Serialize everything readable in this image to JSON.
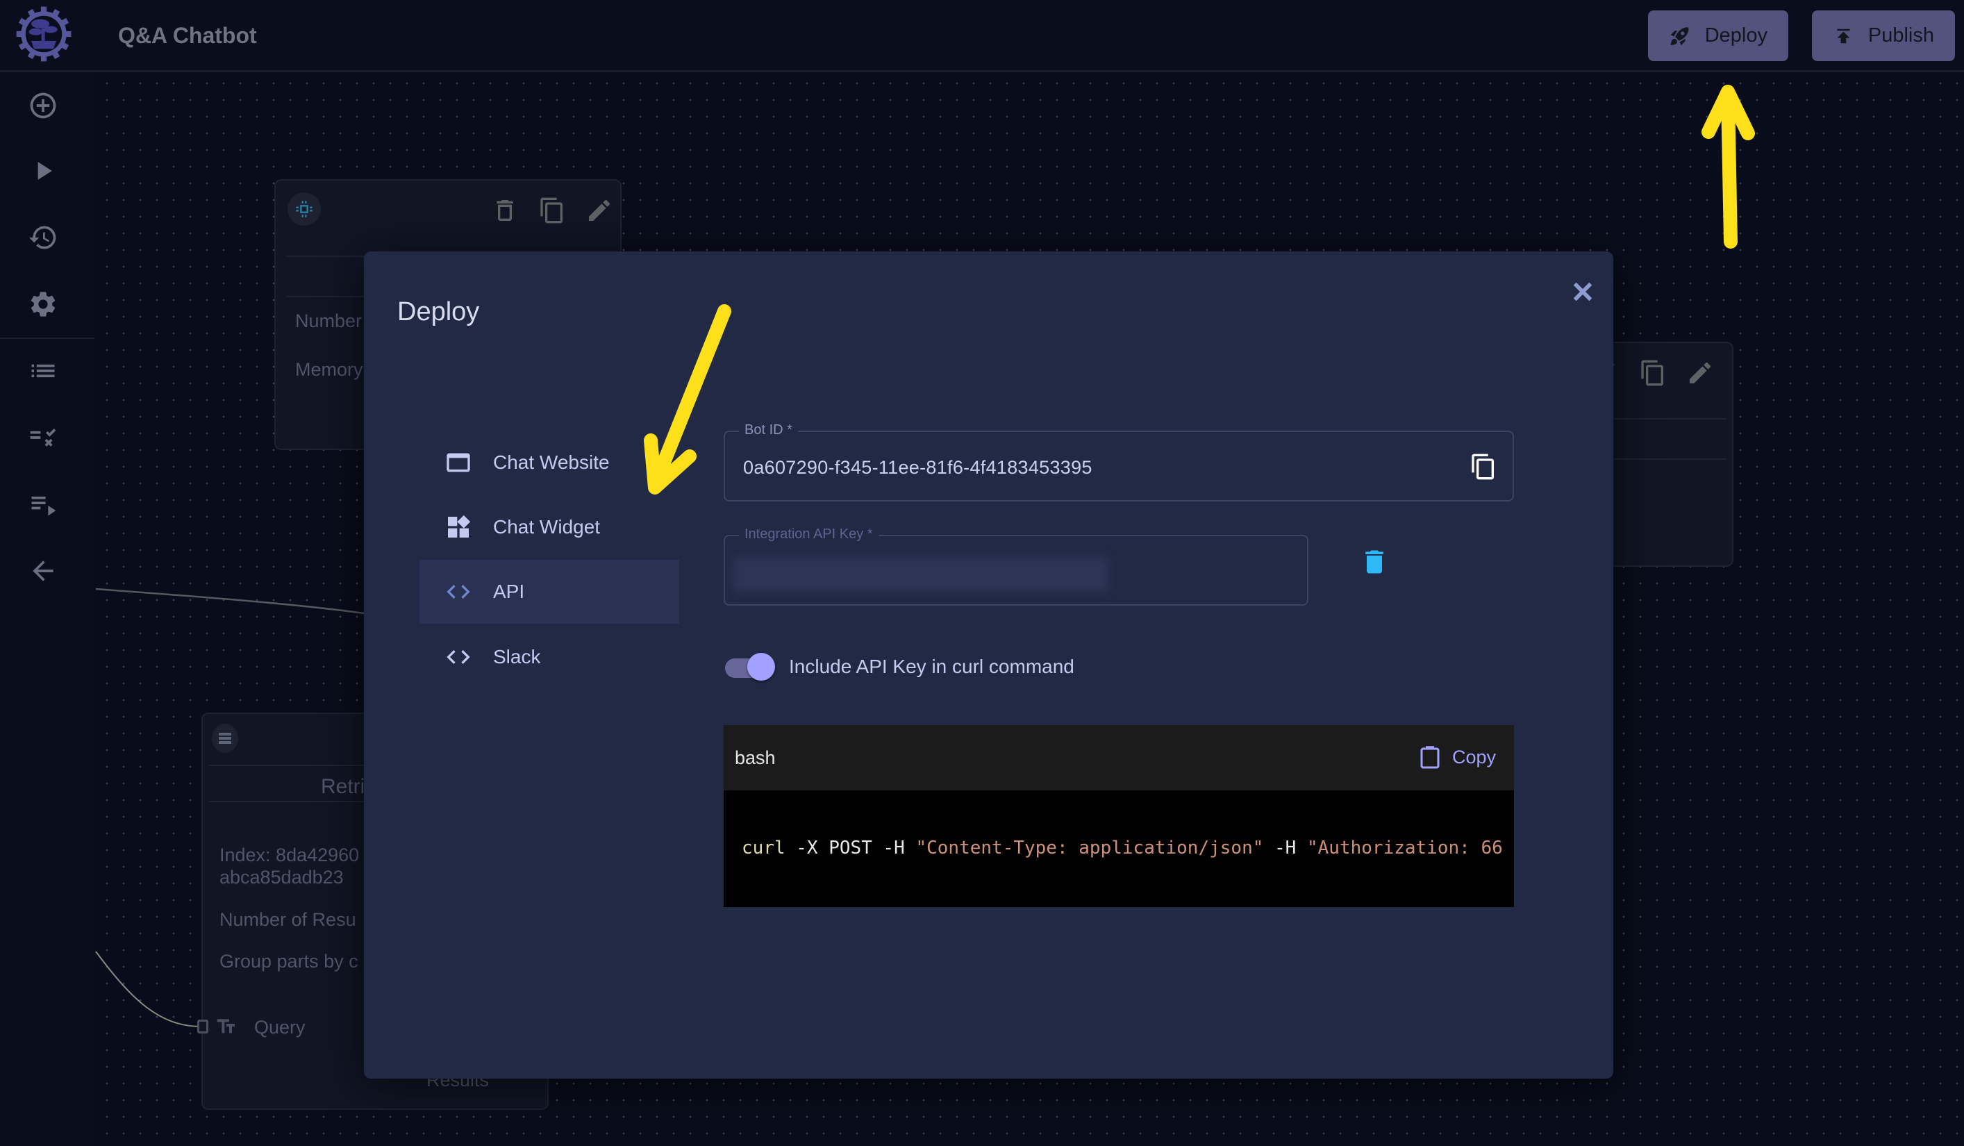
{
  "app": {
    "title": "Q&A Chatbot",
    "logo": "bonsai-gear-logo"
  },
  "header": {
    "deploy_label": "Deploy",
    "publish_label": "Publish",
    "button_color": "#54537e"
  },
  "sidebar": {
    "items": [
      {
        "icon": "add-circle-icon",
        "label": "Add"
      },
      {
        "icon": "play-icon",
        "label": "Run"
      },
      {
        "icon": "history-icon",
        "label": "History"
      },
      {
        "icon": "gear-icon",
        "label": "Settings"
      },
      {
        "icon": "list-icon",
        "label": "List"
      },
      {
        "icon": "checklist-icon",
        "label": "Evaluate"
      },
      {
        "icon": "playlist-play-icon",
        "label": "Playlist"
      },
      {
        "icon": "arrow-back-icon",
        "label": "Back"
      }
    ]
  },
  "canvas": {
    "nodes": [
      {
        "id": "node-top-left",
        "icon": "chip-icon",
        "fields": [
          "Number",
          "Memory"
        ]
      },
      {
        "id": "node-retriever",
        "icon": "stack-icon",
        "title": "Retri",
        "fields": [
          "Index: 8da42960",
          "abca85dadb23",
          "Number of Resu",
          "Group parts by c"
        ],
        "input_label": "Query",
        "output_label": "Results"
      },
      {
        "id": "node-right",
        "fields": []
      }
    ]
  },
  "modal": {
    "title": "Deploy",
    "close_label": "Close",
    "nav": [
      {
        "label": "Chat Website",
        "icon": "browser-window-icon",
        "active": false
      },
      {
        "label": "Chat Widget",
        "icon": "widgets-icon",
        "active": false
      },
      {
        "label": "API",
        "icon": "code-icon",
        "active": true
      },
      {
        "label": "Slack",
        "icon": "code-icon",
        "active": false
      }
    ],
    "bot_id": {
      "label": "Bot ID *",
      "value": "0a607290-f345-11ee-81f6-4f4183453395"
    },
    "api_key": {
      "label": "Integration API Key *",
      "value_hidden": true
    },
    "toggle": {
      "label": "Include API Key in curl command",
      "on": true
    },
    "code": {
      "language": "bash",
      "copy_label": "Copy",
      "tokens": [
        {
          "type": "cmd",
          "text": "curl"
        },
        {
          "type": "plain",
          "text": " -X POST -H "
        },
        {
          "type": "str",
          "text": "\"Content-Type: application/json\""
        },
        {
          "type": "plain",
          "text": " -H "
        },
        {
          "type": "str",
          "text": "\"Authorization: 66"
        }
      ]
    }
  },
  "colors": {
    "accent": "#a3a1ff",
    "trash": "#2eb8f6",
    "annotation": "#fde01a",
    "modal_bg": "#222945"
  }
}
